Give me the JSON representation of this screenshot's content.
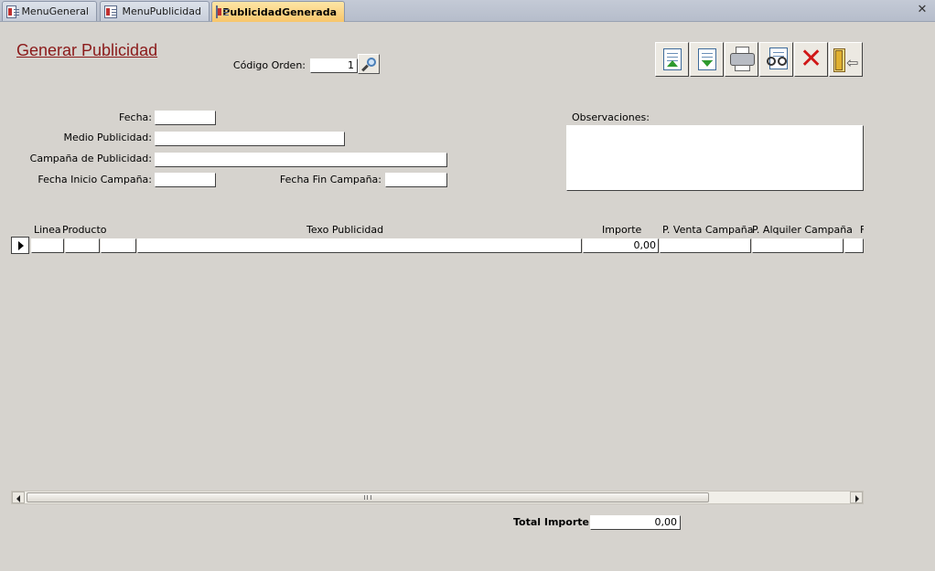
{
  "tabs": [
    {
      "label": "MenuGeneral"
    },
    {
      "label": "MenuPublicidad"
    },
    {
      "label": "PublicidadGenerada"
    }
  ],
  "form": {
    "title": "Generar Publicidad",
    "codigo_orden_label": "Código Orden:",
    "codigo_orden_value": "1",
    "fecha_label": "Fecha:",
    "medio_label": "Medio Publicidad:",
    "campana_label": "Campaña de Publicidad:",
    "fecha_inicio_label": "Fecha Inicio Campaña:",
    "fecha_fin_label": "Fecha Fin Campaña:",
    "observaciones_label": "Observaciones:"
  },
  "grid": {
    "columns": [
      "Linea",
      "Producto",
      "Texo Publicidad",
      "Importe",
      "P. Venta Campaña",
      "P. Alquiler Campaña",
      "F"
    ],
    "row": {
      "importe": "0,00"
    }
  },
  "totals": {
    "label": "Total Importe:",
    "value": "0,00"
  },
  "toolbar": {
    "icons": [
      "new-record-icon",
      "save-record-icon",
      "print-icon",
      "preview-icon",
      "delete-icon",
      "exit-icon"
    ]
  },
  "colors": {
    "title": "#8b1a1a",
    "background": "#d6d3ce",
    "active_tab": "#f7c56a"
  }
}
